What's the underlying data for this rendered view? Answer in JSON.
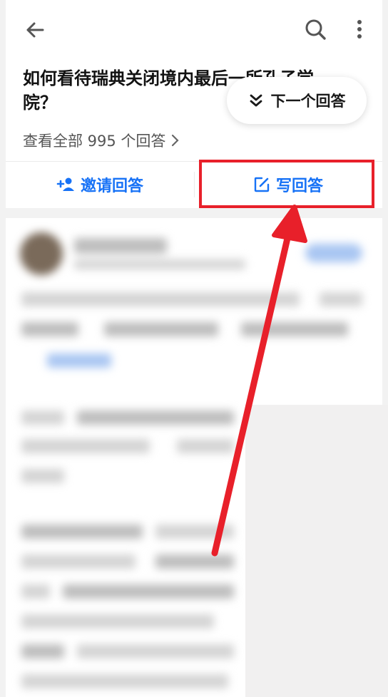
{
  "header": {
    "back_icon": "arrow-left-icon",
    "search_icon": "search-icon",
    "more_icon": "more-vertical-icon"
  },
  "question": {
    "title_line1": "如何看待瑞典关闭境内最后一所孔子学",
    "title_line2": "院？",
    "next_answer_label": "下一个回答",
    "all_answers_label": "查看全部 995 个回答"
  },
  "actions": {
    "invite_label": "邀请回答",
    "write_label": "写回答"
  },
  "colors": {
    "accent": "#1772f6",
    "highlight": "#e8202a"
  }
}
